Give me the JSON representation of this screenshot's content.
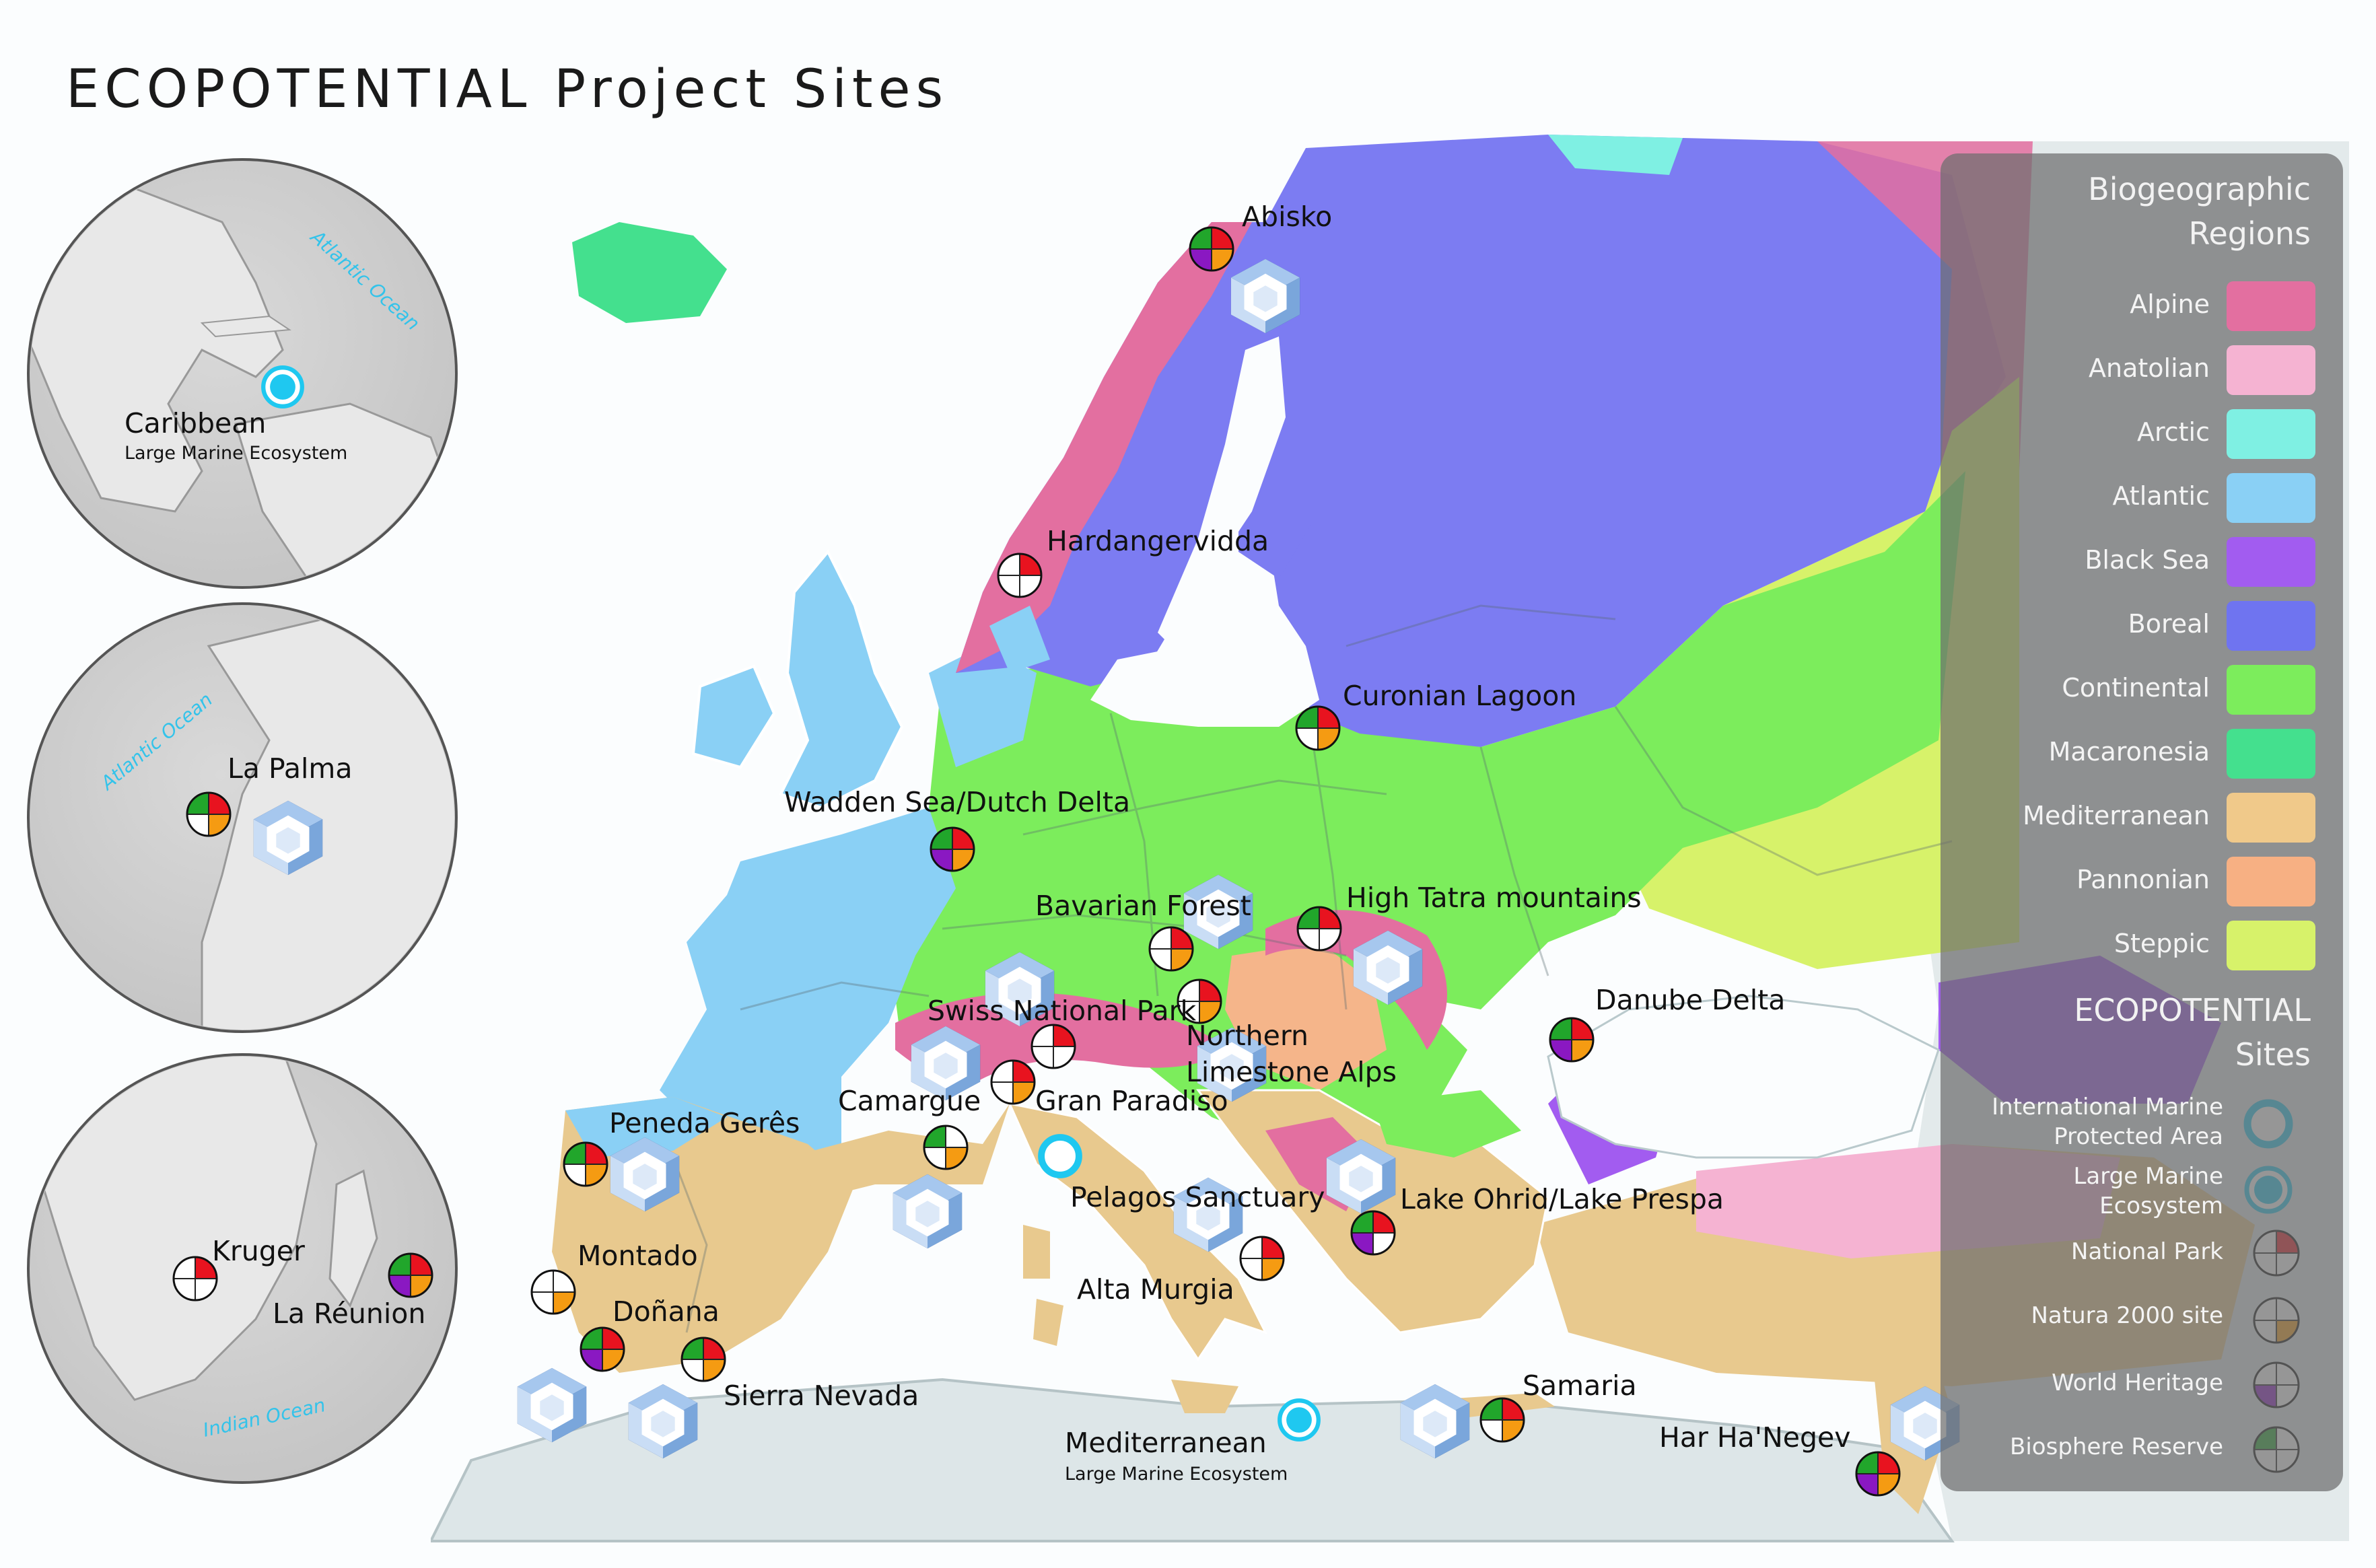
{
  "title": "ECOPOTENTIAL Project Sites",
  "colors": {
    "alpine": "#e36fa0",
    "anatolian": "#f5b3d2",
    "arctic": "#7ff0e3",
    "atlantic": "#8ad0f5",
    "black_sea": "#a25cf0",
    "boreal": "#7c7cf2",
    "continental": "#7ced5c",
    "macaronesia": "#44e08e",
    "mediterranean": "#e8c98e",
    "pannonian": "#f5b58a",
    "steppic": "#d7f26a",
    "np_red": "#e8131f",
    "n2000_orange": "#f59b12",
    "wh_purple": "#8a18c2",
    "br_green": "#21a62b",
    "marine_cyan": "#1fc8f0",
    "cube_blue": "#14377d"
  },
  "sites": {
    "abisko": "Abisko",
    "hardangervidda": "Hardangervidda",
    "curonian": "Curonian Lagoon",
    "wadden": "Wadden Sea/Dutch Delta",
    "bavarian": "Bavarian Forest",
    "tatra": "High Tatra mountains",
    "danube": "Danube Delta",
    "swiss": "Swiss National Park",
    "northern_limestone": "Northern Limestone Alps",
    "camargue": "Camargue",
    "gran_paradiso": "Gran Paradiso",
    "peneda": "Peneda Gerês",
    "pelagos": "Pelagos Sanctuary",
    "ohrid": "Lake Ohrid/Lake Prespa",
    "montado": "Montado",
    "alta_murgia": "Alta Murgia",
    "donana": "Doñana",
    "sierra_nevada": "Sierra Nevada",
    "samaria": "Samaria",
    "mediterranean_lme": "Mediterranean",
    "har_hanegev": "Har Ha'Negev"
  },
  "insets": {
    "caribbean": {
      "label": "Caribbean",
      "sub": "Large Marine Ecosystem",
      "ocean": "Atlantic Ocean"
    },
    "la_palma": {
      "label": "La Palma",
      "ocean": "Atlantic Ocean"
    },
    "africa": {
      "kruger": "Kruger",
      "reunion": "La Réunion",
      "ocean": "Indian Ocean"
    }
  },
  "mediterranean_sub": "Large Marine Ecosystem",
  "legend": {
    "regions_title": [
      "Biogeographic",
      "Regions"
    ],
    "regions": [
      {
        "label": "Alpine",
        "color": "#e36fa0"
      },
      {
        "label": "Anatolian",
        "color": "#f5b3d2"
      },
      {
        "label": "Arctic",
        "color": "#7ff0e3"
      },
      {
        "label": "Atlantic",
        "color": "#8ad0f5"
      },
      {
        "label": "Black Sea",
        "color": "#a25cf0"
      },
      {
        "label": "Boreal",
        "color": "#6f74f0"
      },
      {
        "label": "Continental",
        "color": "#7ced5c"
      },
      {
        "label": "Macaronesia",
        "color": "#44e08e"
      },
      {
        "label": "Mediterranean",
        "color": "#f0c98a"
      },
      {
        "label": "Pannonian",
        "color": "#f7b083"
      },
      {
        "label": "Steppic",
        "color": "#d7f26a"
      }
    ],
    "sites_title": [
      "ECOPOTENTIAL",
      "Sites"
    ],
    "site_types": [
      {
        "label": "International Marine Protected Area",
        "icon": "marine-protected-icon"
      },
      {
        "label": "Large Marine Ecosystem",
        "icon": "marine-ecosystem-icon"
      },
      {
        "label": "National Park",
        "icon": "national-park-icon"
      },
      {
        "label": "Natura 2000 site",
        "icon": "natura-2000-icon"
      },
      {
        "label": "World Heritage",
        "icon": "world-heritage-icon"
      },
      {
        "label": "Biosphere Reserve",
        "icon": "biosphere-reserve-icon"
      }
    ]
  }
}
